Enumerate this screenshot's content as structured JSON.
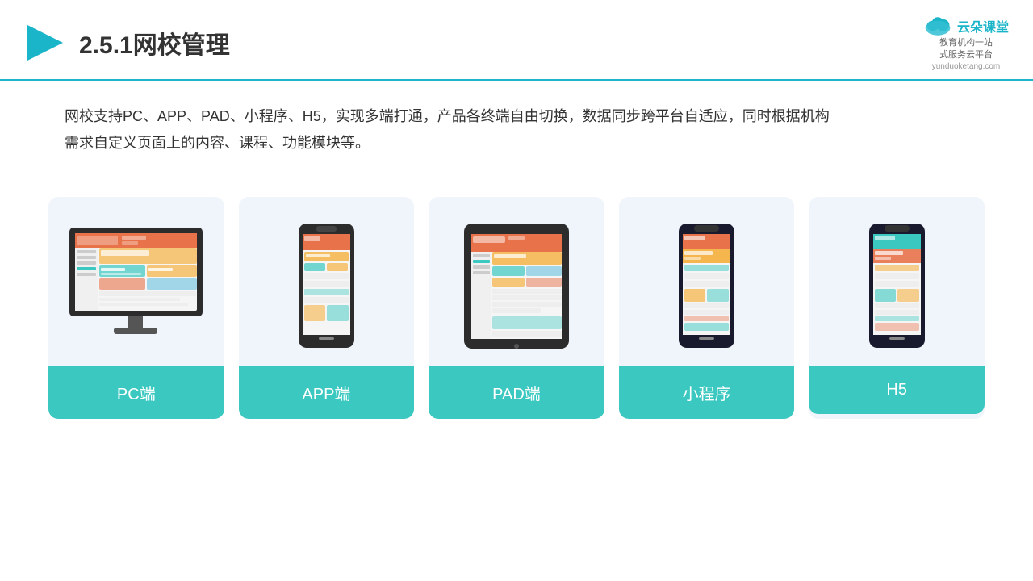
{
  "header": {
    "title": "2.5.1网校管理",
    "logo_text": "云朵课堂",
    "logo_url": "yunduoketang.com",
    "logo_sub": "教育机构一站\n式服务云平台"
  },
  "description": {
    "text1": "网校支持PC、APP、PAD、小程序、H5，实现多端打通，产品各终端自由切换，数据同步跨平台自适应，同时根据机构",
    "text2": "需求自定义页面上的内容、课程、功能模块等。"
  },
  "cards": [
    {
      "id": "pc",
      "label": "PC端"
    },
    {
      "id": "app",
      "label": "APP端"
    },
    {
      "id": "pad",
      "label": "PAD端"
    },
    {
      "id": "miniprogram",
      "label": "小程序"
    },
    {
      "id": "h5",
      "label": "H5"
    }
  ],
  "accent_color": "#3bc8c0",
  "border_color": "#1ab5c8"
}
